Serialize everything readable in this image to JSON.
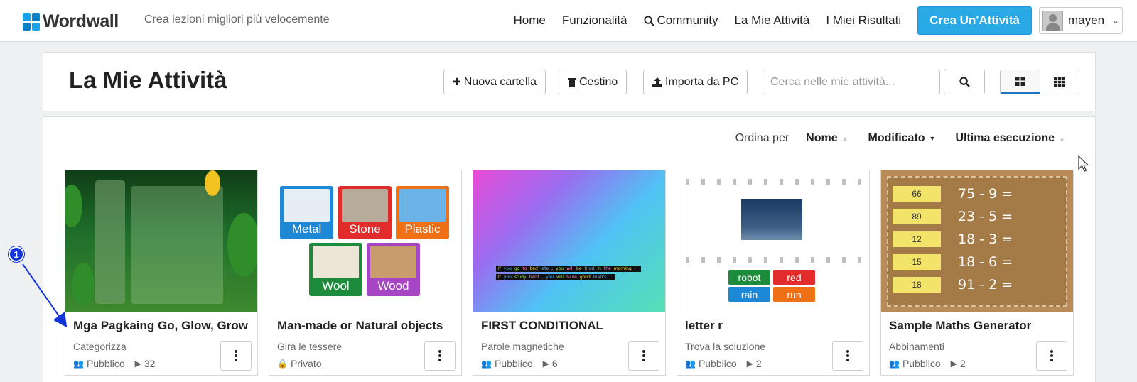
{
  "navbar": {
    "logo": "Wordwall",
    "tagline": "Crea lezioni migliori più velocemente",
    "links": [
      "Home",
      "Funzionalità",
      "Community",
      "La Mie Attività",
      "I Miei Risultati"
    ],
    "create_button": "Crea Un'Attività",
    "user_name": "mayen"
  },
  "header": {
    "title": "La Mie Attività",
    "new_folder": "Nuova cartella",
    "trash": "Cestino",
    "import": "Importa da PC",
    "search_placeholder": "Cerca nelle mie attività..."
  },
  "sort": {
    "label": "Ordina per",
    "options": [
      "Nome",
      "Modificato",
      "Ultima esecuzione"
    ]
  },
  "cards": [
    {
      "title": "Mga Pagkaing Go, Glow, Grow",
      "type": "Categorizza",
      "visibility": "Pubblico",
      "plays": "32"
    },
    {
      "title": "Man-made or Natural objects",
      "type": "Gira le tessere",
      "visibility": "Privato",
      "plays": ""
    },
    {
      "title": "FIRST CONDITIONAL",
      "type": "Parole magnetiche",
      "visibility": "Pubblico",
      "plays": "6"
    },
    {
      "title": "letter r",
      "type": "Trova la soluzione",
      "visibility": "Pubblico",
      "plays": "2"
    },
    {
      "title": "Sample Maths Generator",
      "type": "Abbinamenti",
      "visibility": "Pubblico",
      "plays": "2"
    }
  ],
  "thumb_objects": [
    "Metal",
    "Stone",
    "Plastic",
    "Wool",
    "Wood"
  ],
  "thumb_cond": [
    [
      "If",
      "you",
      "go",
      "to",
      "bed",
      "late",
      ",",
      "you",
      "will",
      "be",
      "tired",
      "in",
      "the",
      "morning",
      "."
    ],
    [
      "If",
      "you",
      "study",
      "hard",
      ",",
      "you",
      "will",
      "have",
      "good",
      "marks",
      "."
    ]
  ],
  "thumb_words": [
    "robot",
    "red",
    "rain",
    "run"
  ],
  "thumb_notes": [
    "66",
    "89",
    "12",
    "15",
    "18"
  ],
  "thumb_eqs": [
    "75 - 9 =",
    "23 - 5 =",
    "18 - 3 =",
    "18 - 6 =",
    "91 - 2 ="
  ],
  "annotation": "1",
  "colors": {
    "accent": "#29a9e6",
    "annotation": "#1334d8"
  }
}
